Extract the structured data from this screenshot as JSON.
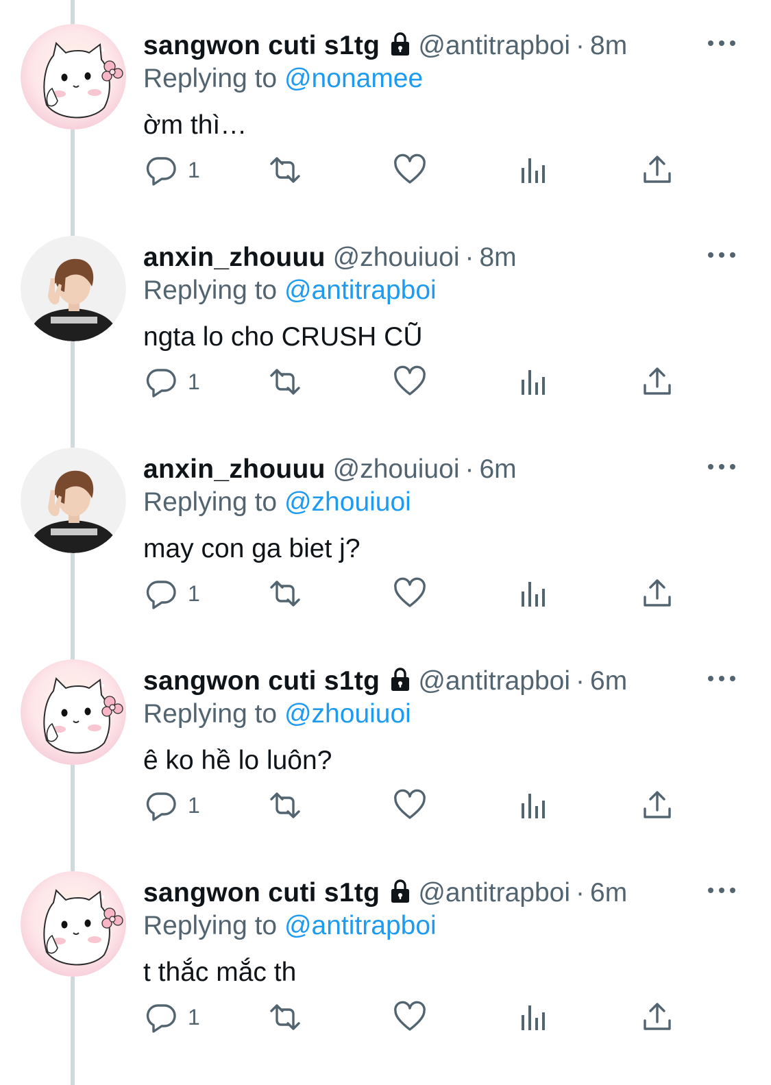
{
  "tweets": [
    {
      "display_name": "sangwon cuti s1tg",
      "locked": true,
      "avatar": "hello-kitty",
      "handle": "@antitrapboi",
      "separator": "·",
      "time": "8m",
      "replying_prefix": "Replying to",
      "replying_to": "@nonamee",
      "text": "ờm thì…",
      "reply_count": "1"
    },
    {
      "display_name": "anxin_zhouuu",
      "locked": false,
      "avatar": "boy-photo",
      "handle": "@zhouiuoi",
      "separator": "·",
      "time": "8m",
      "replying_prefix": "Replying to",
      "replying_to": "@antitrapboi",
      "text": "ngta lo cho CRUSH CŨ",
      "reply_count": "1"
    },
    {
      "display_name": "anxin_zhouuu",
      "locked": false,
      "avatar": "boy-photo",
      "handle": "@zhouiuoi",
      "separator": "·",
      "time": "6m",
      "replying_prefix": "Replying to",
      "replying_to": "@zhouiuoi",
      "text": "may con ga biet j?",
      "reply_count": "1"
    },
    {
      "display_name": "sangwon cuti s1tg",
      "locked": true,
      "avatar": "hello-kitty",
      "handle": "@antitrapboi",
      "separator": "·",
      "time": "6m",
      "replying_prefix": "Replying to",
      "replying_to": "@zhouiuoi",
      "text": "ê ko hề lo luôn?",
      "reply_count": "1"
    },
    {
      "display_name": "sangwon cuti s1tg",
      "locked": true,
      "avatar": "hello-kitty",
      "handle": "@antitrapboi",
      "separator": "·",
      "time": "6m",
      "replying_prefix": "Replying to",
      "replying_to": "@antitrapboi",
      "text": "t thắc mắc th",
      "reply_count": "1"
    }
  ],
  "icons": {
    "reply": "reply-icon",
    "retweet": "retweet-icon",
    "like": "heart-icon",
    "views": "views-icon",
    "share": "share-icon",
    "more": "more-icon",
    "lock": "lock-icon"
  },
  "colors": {
    "text": "#0f1419",
    "secondary": "#536471",
    "link": "#1d9bf0",
    "thread_line": "#cfd9de"
  }
}
